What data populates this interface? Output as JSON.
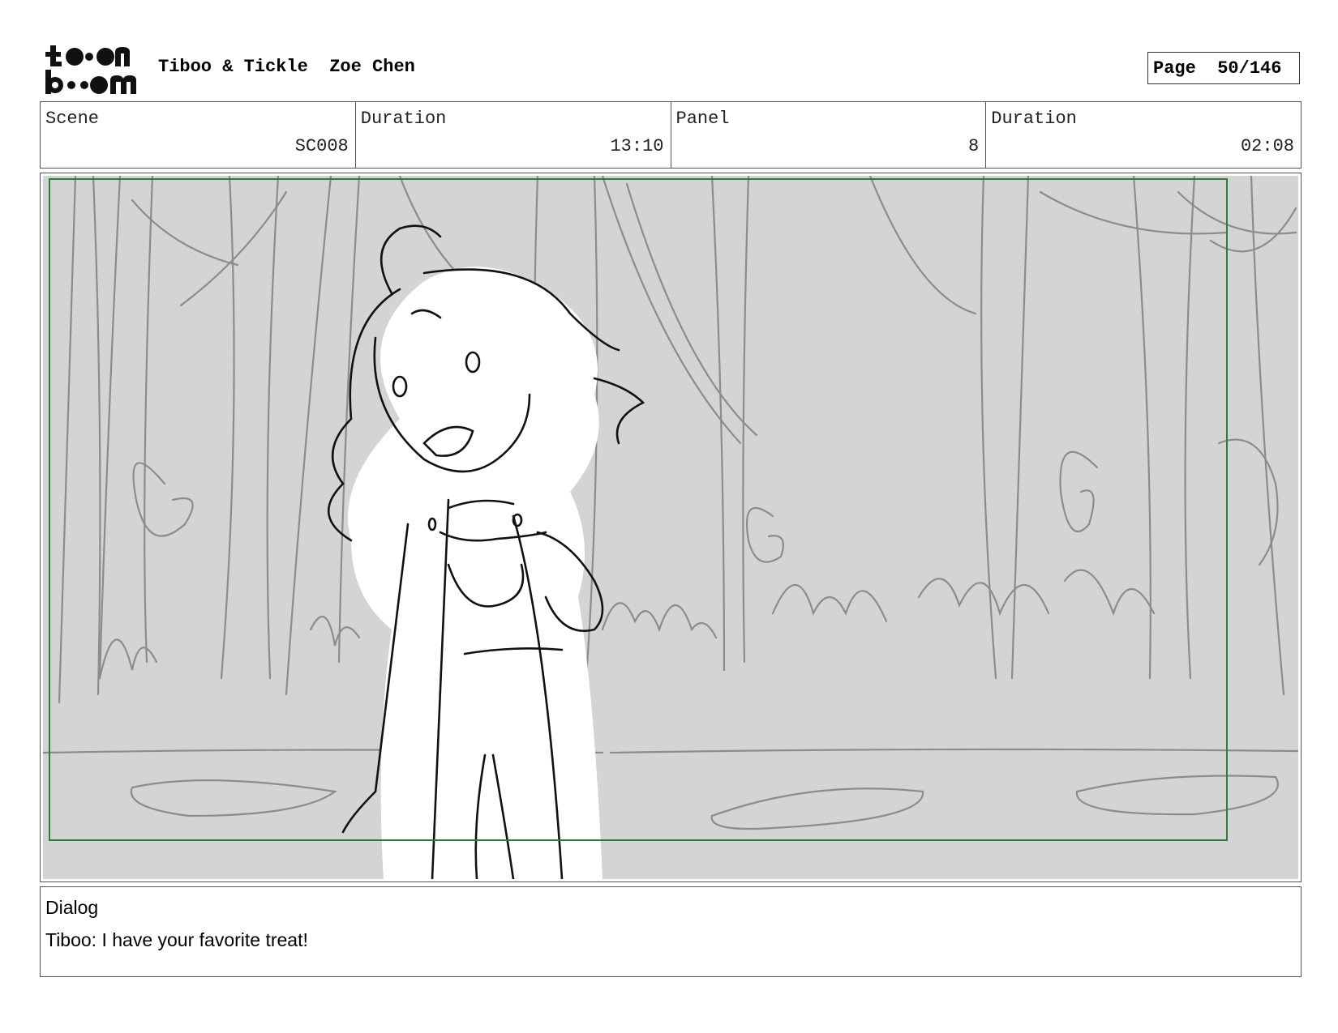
{
  "header": {
    "logo_text": "toon boom",
    "title": "Tiboo & Tickle  Zoe Chen",
    "page": "Page  50/146"
  },
  "info": [
    {
      "label": "Scene",
      "value": "SC008"
    },
    {
      "label": "Duration",
      "value": "13:10"
    },
    {
      "label": "Panel",
      "value": "8"
    },
    {
      "label": "Duration",
      "value": "02:08"
    }
  ],
  "panel": {
    "icon": "storyboard-sketch-forest-girl",
    "safe_frame_color": "#2e7d32",
    "background_color": "#d4d4d4"
  },
  "dialog": {
    "label": "Dialog",
    "text": "Tiboo: I have your favorite treat!"
  }
}
